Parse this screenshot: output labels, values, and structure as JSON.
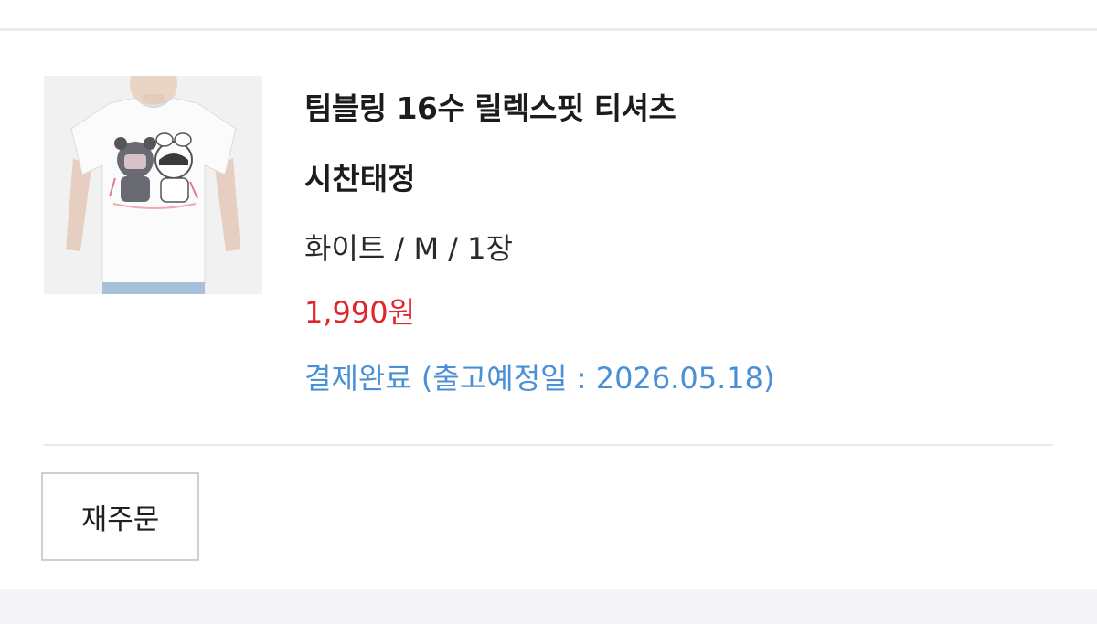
{
  "order": {
    "product_name": "팀블링 16수 릴렉스핏 티셔츠",
    "variant": "시찬태정",
    "options": "화이트 / M / 1장",
    "price": "1,990원",
    "status": "결제완료 (출고예정일 : 2026.05.18)",
    "price_color": "#e0252d",
    "status_color": "#4a90d9",
    "thumbnail_icon": "tshirt-product-photo"
  },
  "actions": {
    "reorder_label": "재주문"
  }
}
